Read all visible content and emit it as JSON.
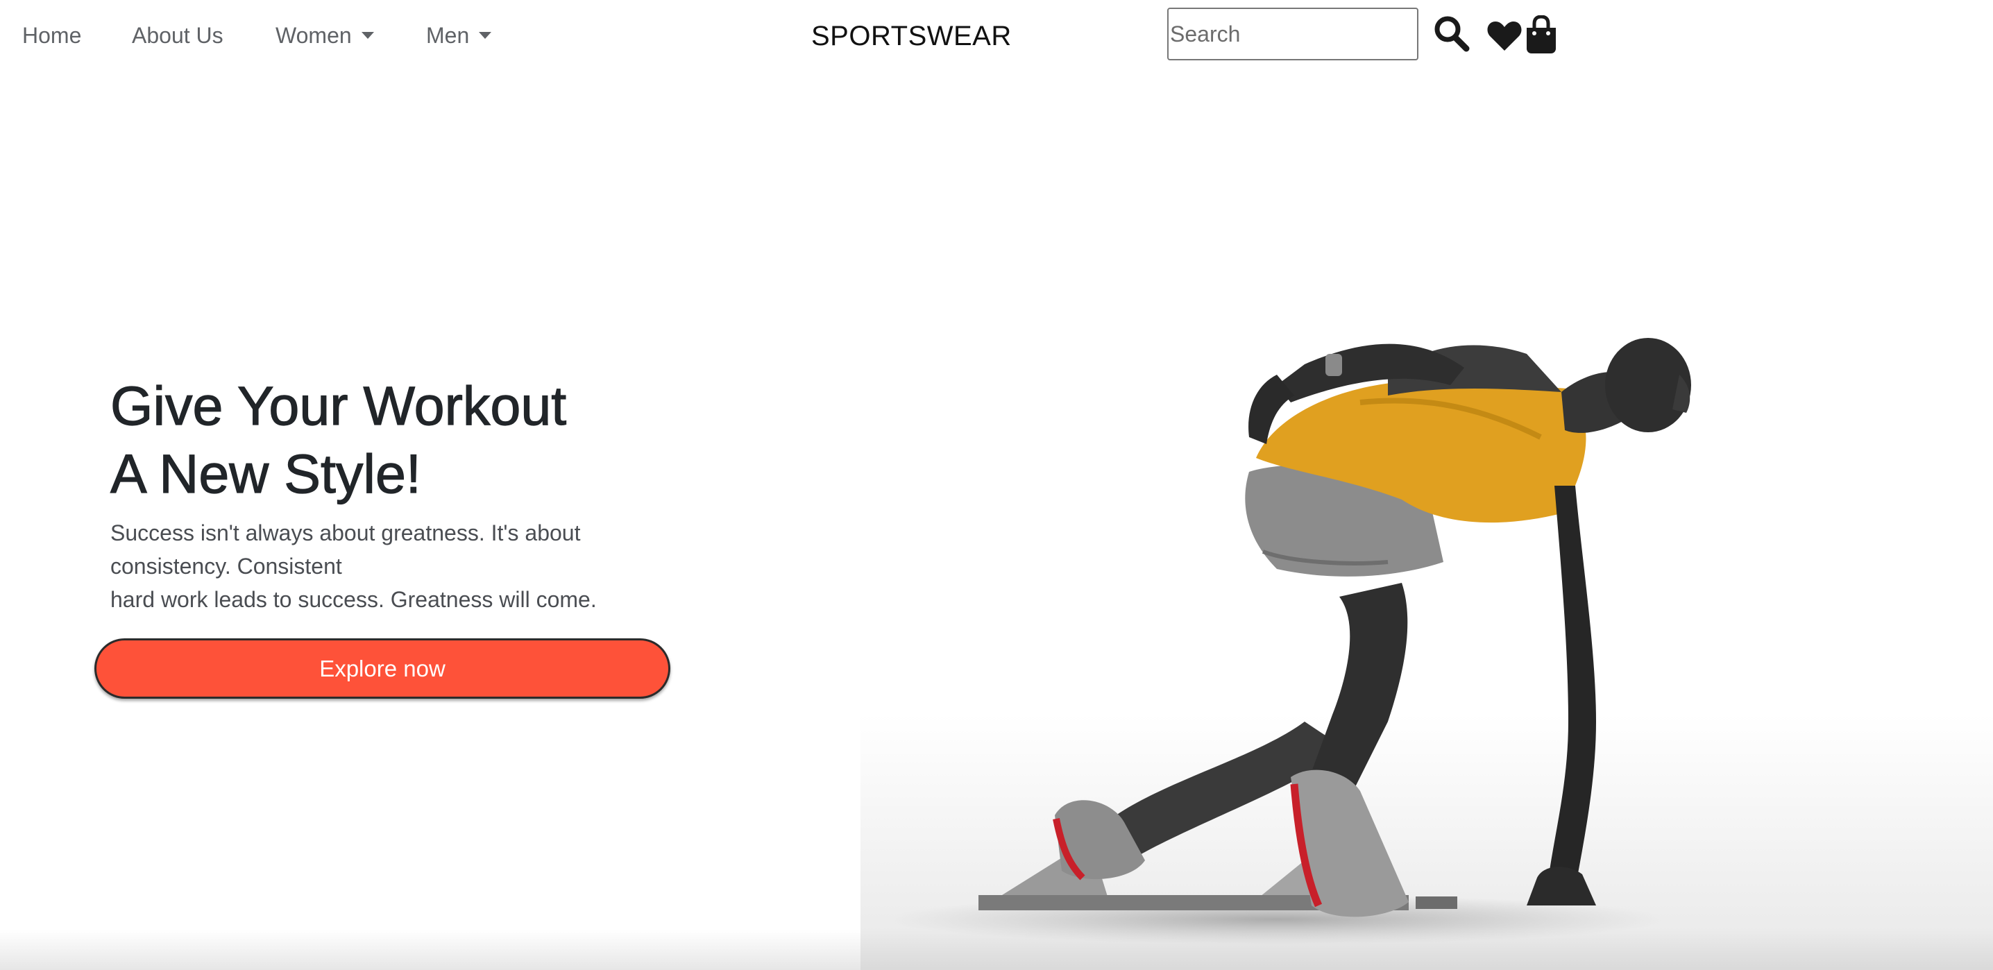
{
  "nav": {
    "items": [
      {
        "label": "Home"
      },
      {
        "label": "About Us"
      },
      {
        "label": "Women",
        "dropdown": true
      },
      {
        "label": "Men",
        "dropdown": true
      }
    ],
    "brand": "SPORTSWEAR",
    "search": {
      "placeholder": "Search",
      "value": ""
    },
    "icons": [
      "search-icon",
      "heart-icon",
      "shopping-bag-icon"
    ]
  },
  "hero": {
    "title_line1": "Give Your Workout",
    "title_line2": "A New Style!",
    "subtitle_line1": "Success isn't always about greatness. It's about",
    "subtitle_line2": "consistency. Consistent",
    "subtitle_line3": "hard work leads to success. Greatness will come.",
    "cta_label": "Explore now",
    "image_description": ""
  },
  "colors": {
    "accent": "#fe5239",
    "text_dark": "#212529",
    "nav_text": "#5f6266",
    "shirt": "#e0a020"
  }
}
